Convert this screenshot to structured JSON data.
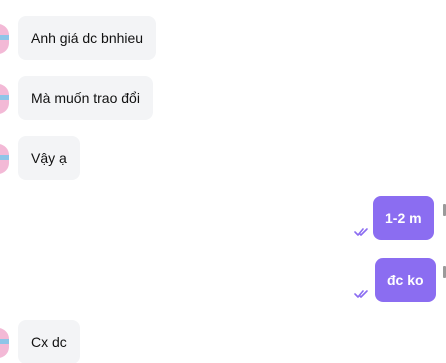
{
  "messages": [
    {
      "side": "incoming",
      "text": "Anh giá dc bnhieu"
    },
    {
      "side": "incoming",
      "text": "Mà muốn trao đổi"
    },
    {
      "side": "incoming",
      "text": "Vậy ạ"
    },
    {
      "side": "outgoing",
      "text": "1-2 m",
      "status_icon": "double-check-icon"
    },
    {
      "side": "outgoing",
      "text": "đc ko",
      "status_icon": "double-check-icon"
    },
    {
      "side": "incoming",
      "text": "Cx dc"
    }
  ],
  "colors": {
    "incoming_bubble": "#f3f4f6",
    "outgoing_bubble": "#8b6df1",
    "read_check": "#8b6df1"
  }
}
